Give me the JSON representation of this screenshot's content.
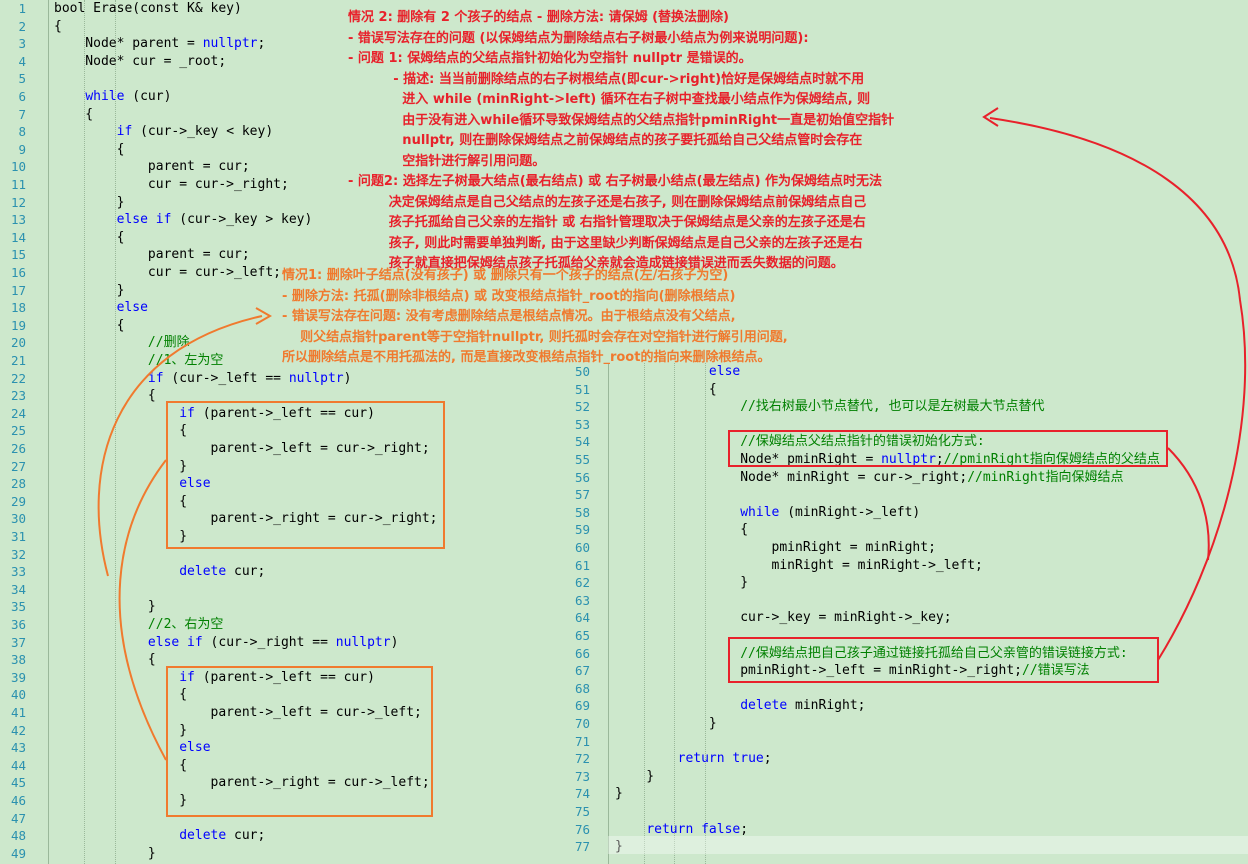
{
  "left_code": {
    "first_line": 1,
    "lines": [
      [
        [
          "t",
          "bool Erase(const K& key)"
        ]
      ],
      [
        [
          "t",
          "{"
        ]
      ],
      [
        [
          "t",
          "    Node* parent = "
        ],
        [
          "k",
          "nullptr"
        ],
        [
          "t",
          ";"
        ]
      ],
      [
        [
          "t",
          "    Node* cur = _root;"
        ]
      ],
      [
        [
          "t",
          ""
        ]
      ],
      [
        [
          "t",
          "    "
        ],
        [
          "k",
          "while"
        ],
        [
          "t",
          " (cur)"
        ]
      ],
      [
        [
          "t",
          "    {"
        ]
      ],
      [
        [
          "t",
          "        "
        ],
        [
          "k",
          "if"
        ],
        [
          "t",
          " (cur->_key < key)"
        ]
      ],
      [
        [
          "t",
          "        {"
        ]
      ],
      [
        [
          "t",
          "            parent = cur;"
        ]
      ],
      [
        [
          "t",
          "            cur = cur->_right;"
        ]
      ],
      [
        [
          "t",
          "        }"
        ]
      ],
      [
        [
          "t",
          "        "
        ],
        [
          "k",
          "else if"
        ],
        [
          "t",
          " (cur->_key > key)"
        ]
      ],
      [
        [
          "t",
          "        {"
        ]
      ],
      [
        [
          "t",
          "            parent = cur;"
        ]
      ],
      [
        [
          "t",
          "            cur = cur->_left;"
        ]
      ],
      [
        [
          "t",
          "        }"
        ]
      ],
      [
        [
          "t",
          "        "
        ],
        [
          "k",
          "else"
        ]
      ],
      [
        [
          "t",
          "        {"
        ]
      ],
      [
        [
          "t",
          "            "
        ],
        [
          "c",
          "//删除"
        ]
      ],
      [
        [
          "t",
          "            "
        ],
        [
          "c",
          "//1、左为空"
        ]
      ],
      [
        [
          "t",
          "            "
        ],
        [
          "k",
          "if"
        ],
        [
          "t",
          " (cur->_left == "
        ],
        [
          "k",
          "nullptr"
        ],
        [
          "t",
          ")"
        ]
      ],
      [
        [
          "t",
          "            {"
        ]
      ],
      [
        [
          "t",
          "                "
        ],
        [
          "k",
          "if"
        ],
        [
          "t",
          " (parent->_left == cur)"
        ]
      ],
      [
        [
          "t",
          "                {"
        ]
      ],
      [
        [
          "t",
          "                    parent->_left = cur->_right;"
        ]
      ],
      [
        [
          "t",
          "                }"
        ]
      ],
      [
        [
          "t",
          "                "
        ],
        [
          "k",
          "else"
        ]
      ],
      [
        [
          "t",
          "                {"
        ]
      ],
      [
        [
          "t",
          "                    parent->_right = cur->_right;"
        ]
      ],
      [
        [
          "t",
          "                }"
        ]
      ],
      [
        [
          "t",
          ""
        ]
      ],
      [
        [
          "t",
          "                "
        ],
        [
          "k",
          "delete"
        ],
        [
          "t",
          " cur;"
        ]
      ],
      [
        [
          "t",
          ""
        ]
      ],
      [
        [
          "t",
          "            }"
        ]
      ],
      [
        [
          "t",
          "            "
        ],
        [
          "c",
          "//2、右为空"
        ]
      ],
      [
        [
          "t",
          "            "
        ],
        [
          "k",
          "else if"
        ],
        [
          "t",
          " (cur->_right == "
        ],
        [
          "k",
          "nullptr"
        ],
        [
          "t",
          ")"
        ]
      ],
      [
        [
          "t",
          "            {"
        ]
      ],
      [
        [
          "t",
          "                "
        ],
        [
          "k",
          "if"
        ],
        [
          "t",
          " (parent->_left == cur)"
        ]
      ],
      [
        [
          "t",
          "                {"
        ]
      ],
      [
        [
          "t",
          "                    parent->_left = cur->_left;"
        ]
      ],
      [
        [
          "t",
          "                }"
        ]
      ],
      [
        [
          "t",
          "                "
        ],
        [
          "k",
          "else"
        ]
      ],
      [
        [
          "t",
          "                {"
        ]
      ],
      [
        [
          "t",
          "                    parent->_right = cur->_left;"
        ]
      ],
      [
        [
          "t",
          "                }"
        ]
      ],
      [
        [
          "t",
          ""
        ]
      ],
      [
        [
          "t",
          "                "
        ],
        [
          "k",
          "delete"
        ],
        [
          "t",
          " cur;"
        ]
      ],
      [
        [
          "t",
          "            }"
        ]
      ]
    ]
  },
  "right_code": {
    "first_line": 50,
    "lines": [
      [
        [
          "t",
          "            "
        ],
        [
          "k",
          "else"
        ]
      ],
      [
        [
          "t",
          "            {"
        ]
      ],
      [
        [
          "t",
          "                "
        ],
        [
          "c",
          "//找右树最小节点替代, 也可以是左树最大节点替代"
        ]
      ],
      [
        [
          "t",
          ""
        ]
      ],
      [
        [
          "t",
          "                "
        ],
        [
          "c",
          "//保姆结点父结点指针的错误初始化方式:"
        ]
      ],
      [
        [
          "t",
          "                Node* pminRight = "
        ],
        [
          "k",
          "nullptr"
        ],
        [
          "t",
          ";"
        ],
        [
          "c",
          "//pminRight指向保姆结点的父结点"
        ]
      ],
      [
        [
          "t",
          "                Node* minRight = cur->_right;"
        ],
        [
          "c",
          "//minRight指向保姆结点"
        ]
      ],
      [
        [
          "t",
          ""
        ]
      ],
      [
        [
          "t",
          "                "
        ],
        [
          "k",
          "while"
        ],
        [
          "t",
          " (minRight->_left)"
        ]
      ],
      [
        [
          "t",
          "                {"
        ]
      ],
      [
        [
          "t",
          "                    pminRight = minRight;"
        ]
      ],
      [
        [
          "t",
          "                    minRight = minRight->_left;"
        ]
      ],
      [
        [
          "t",
          "                }"
        ]
      ],
      [
        [
          "t",
          ""
        ]
      ],
      [
        [
          "t",
          "                cur->_key = minRight->_key;"
        ]
      ],
      [
        [
          "t",
          ""
        ]
      ],
      [
        [
          "t",
          "                "
        ],
        [
          "c",
          "//保姆结点把自己孩子通过链接托孤给自己父亲管的错误链接方式:"
        ]
      ],
      [
        [
          "t",
          "                pminRight->_left = minRight->_right;"
        ],
        [
          "c",
          "//错误写法"
        ]
      ],
      [
        [
          "t",
          ""
        ]
      ],
      [
        [
          "t",
          "                "
        ],
        [
          "k",
          "delete"
        ],
        [
          "t",
          " minRight;"
        ]
      ],
      [
        [
          "t",
          "            }"
        ]
      ],
      [
        [
          "t",
          ""
        ]
      ],
      [
        [
          "t",
          "        "
        ],
        [
          "k",
          "return"
        ],
        [
          "t",
          " "
        ],
        [
          "k",
          "true"
        ],
        [
          "t",
          ";"
        ]
      ],
      [
        [
          "t",
          "    }"
        ]
      ],
      [
        [
          "t",
          "}"
        ]
      ],
      [
        [
          "t",
          ""
        ]
      ],
      [
        [
          "t",
          "    "
        ],
        [
          "k",
          "return"
        ],
        [
          "t",
          " "
        ],
        [
          "k",
          "false"
        ],
        [
          "t",
          ";"
        ]
      ],
      [
        [
          "t",
          "}"
        ]
      ]
    ]
  },
  "notes": {
    "case2": [
      "情况 2: 删除有 2 个孩子的结点 - 删除方法: 请保姆 (替换法删除)",
      "- 错误写法存在的问题 (以保姆结点为删除结点右子树最小结点为例来说明问题):",
      "- 问题 1: 保姆结点的父结点指针初始化为空指针 nullptr 是错误的。",
      "          - 描述: 当当前删除结点的右子树根结点(即cur->right)恰好是保姆结点时就不用",
      "            进入 while (minRight->left) 循环在右子树中查找最小结点作为保姆结点, 则",
      "            由于没有进入while循环导致保姆结点的父结点指针pminRight一直是初始值空指针",
      "            nullptr, 则在删除保姆结点之前保姆结点的孩子要托孤给自己父结点管时会存在",
      "            空指针进行解引用问题。",
      "- 问题2: 选择左子树最大结点(最右结点) 或 右子树最小结点(最左结点) 作为保姆结点时无法",
      "         决定保姆结点是自己父结点的左孩子还是右孩子, 则在删除保姆结点前保姆结点自己",
      "         孩子托孤给自己父亲的左指针 或 右指针管理取决于保姆结点是父亲的左孩子还是右",
      "         孩子, 则此时需要单独判断, 由于这里缺少判断保姆结点是自己父亲的左孩子还是右",
      "         孩子就直接把保姆结点孩子托孤给父亲就会造成链接错误进而丢失数据的问题。"
    ],
    "case1": [
      "情况1: 删除叶子结点(没有孩子) 或 删除只有一个孩子的结点(左/右孩子为空)",
      "- 删除方法: 托孤(删除非根结点) 或 改变根结点指针_root的指向(删除根结点)",
      "- 错误写法存在问题: 没有考虑删除结点是根结点情况。由于根结点没有父结点,",
      "    则父结点指针parent等于空指针nullptr, 则托孤时会存在对空指针进行解引用问题,",
      "所以删除结点是不用托孤法的, 而是直接改变根结点指针_root的指向来删除根结点。"
    ]
  },
  "colors": {
    "background": "#cde8cc",
    "keyword": "#0000ff",
    "comment": "#008000",
    "line_number": "#2b91af",
    "annotation_red": "#e8212b",
    "annotation_orange": "#f07a2e"
  }
}
